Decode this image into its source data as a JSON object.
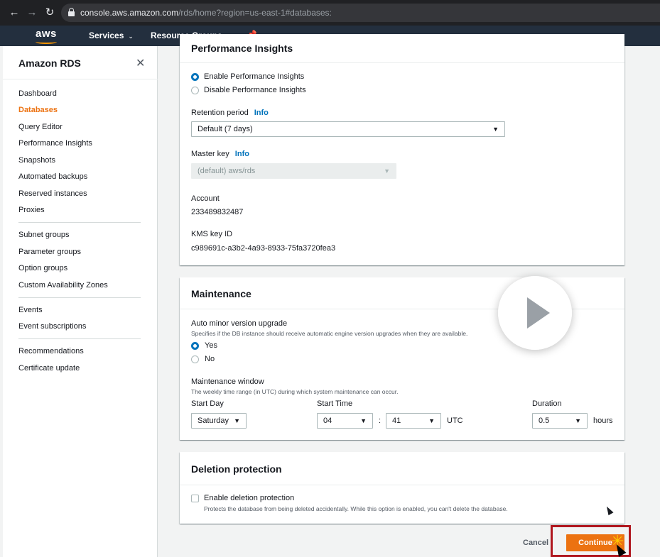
{
  "browser": {
    "url_host": "console.aws.amazon.com",
    "url_path": "/rds/home?region=us-east-1#databases:"
  },
  "aws_nav": {
    "logo": "aws",
    "services_label": "Services",
    "resource_groups_label": "Resource Groups"
  },
  "sidebar": {
    "title": "Amazon RDS",
    "items": [
      {
        "label": "Dashboard"
      },
      {
        "label": "Databases",
        "active": true
      },
      {
        "label": "Query Editor"
      },
      {
        "label": "Performance Insights"
      },
      {
        "label": "Snapshots"
      },
      {
        "label": "Automated backups"
      },
      {
        "label": "Reserved instances"
      },
      {
        "label": "Proxies"
      },
      {
        "label": "Subnet groups"
      },
      {
        "label": "Parameter groups"
      },
      {
        "label": "Option groups"
      },
      {
        "label": "Custom Availability Zones"
      },
      {
        "label": "Events"
      },
      {
        "label": "Event subscriptions"
      },
      {
        "label": "Recommendations"
      },
      {
        "label": "Certificate update"
      }
    ]
  },
  "performance_insights": {
    "title": "Performance Insights",
    "enable_label": "Enable Performance Insights",
    "disable_label": "Disable Performance Insights",
    "selected": "enable",
    "retention_label": "Retention period",
    "info_label": "Info",
    "retention_value": "Default (7 days)",
    "master_key_label": "Master key",
    "master_key_value": "(default) aws/rds",
    "account_label": "Account",
    "account_value": "233489832487",
    "kms_label": "KMS key ID",
    "kms_value": "c989691c-a3b2-4a93-8933-75fa3720fea3"
  },
  "maintenance": {
    "title": "Maintenance",
    "auto_minor_label": "Auto minor version upgrade",
    "auto_minor_desc": "Specifies if the DB instance should receive automatic engine version upgrades when they are available.",
    "yes_label": "Yes",
    "no_label": "No",
    "selected": "yes",
    "window_label": "Maintenance window",
    "window_desc": "The weekly time range (in UTC) during which system maintenance can occur.",
    "start_day_label": "Start Day",
    "start_day_value": "Saturday",
    "start_time_label": "Start Time",
    "hour_value": "04",
    "colon": ":",
    "minute_value": "41",
    "utc_label": "UTC",
    "duration_label": "Duration",
    "duration_value": "0.5",
    "hours_label": "hours"
  },
  "deletion_protection": {
    "title": "Deletion protection",
    "checkbox_label": "Enable deletion protection",
    "checkbox_desc": "Protects the database from being deleted accidentally. While this option is enabled, you can't delete the database.",
    "checked": false
  },
  "footer": {
    "cancel_label": "Cancel",
    "continue_label": "Continue"
  },
  "colors": {
    "accent": "#ec7211",
    "link": "#0073bb",
    "highlight": "#b0171f"
  }
}
